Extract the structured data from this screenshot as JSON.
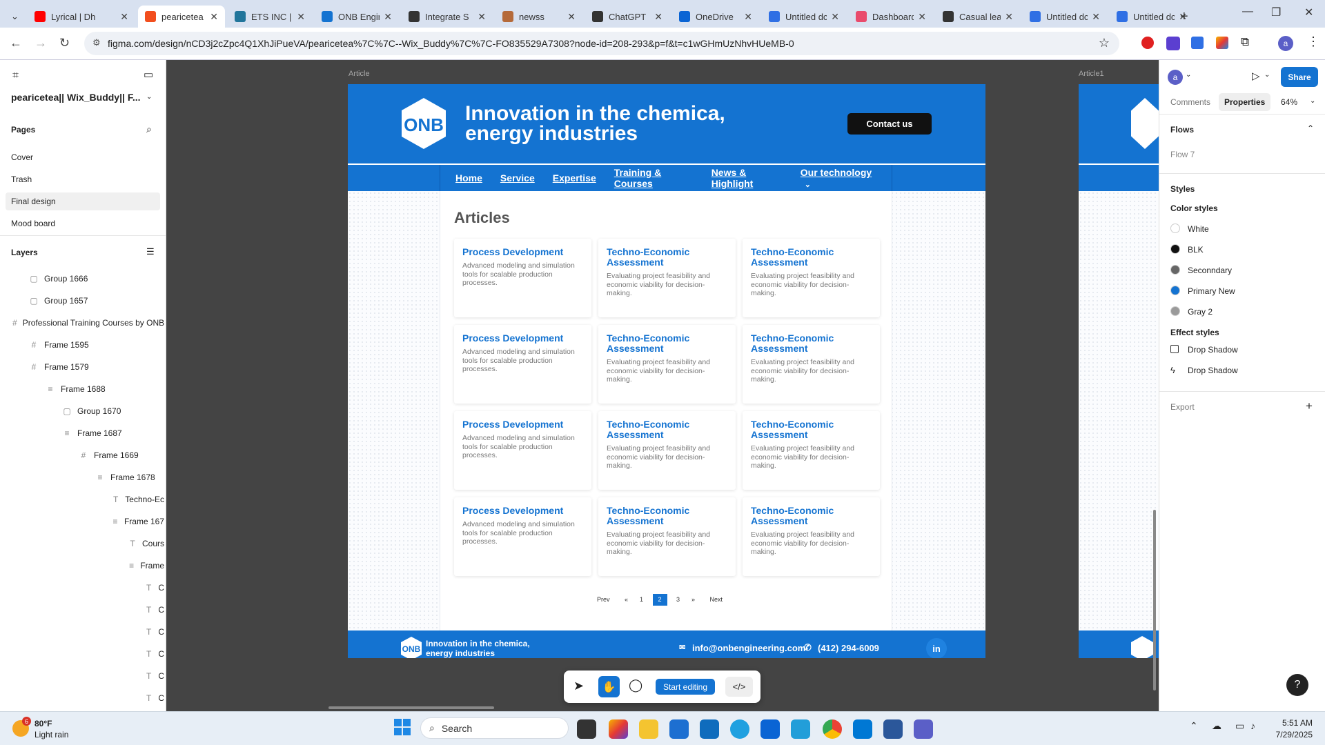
{
  "browser": {
    "tabs": [
      {
        "title": "Lyrical | Dh",
        "icon": "youtube-icon",
        "color": "#ff0000",
        "active": false
      },
      {
        "title": "pearicetea",
        "icon": "figma-icon",
        "color": "#f24e1e",
        "active": true
      },
      {
        "title": "ETS INC | t",
        "icon": "wordpress-icon",
        "color": "#21759b",
        "active": false
      },
      {
        "title": "ONB Engin",
        "icon": "onb-icon",
        "color": "#1473d1",
        "active": false
      },
      {
        "title": "Integrate S",
        "icon": "chatgpt-icon",
        "color": "#333333",
        "active": false
      },
      {
        "title": "newss",
        "icon": "doc-icon",
        "color": "#b56a3a",
        "active": false
      },
      {
        "title": "ChatGPT",
        "icon": "chatgpt-icon",
        "color": "#333333",
        "active": false
      },
      {
        "title": "OneDrive",
        "icon": "onedrive-icon",
        "color": "#0a64d4",
        "active": false
      },
      {
        "title": "Untitled dc",
        "icon": "docs-icon",
        "color": "#2f6fe4",
        "active": false
      },
      {
        "title": "Dashboard",
        "icon": "dashboard-icon",
        "color": "#e94b6c",
        "active": false
      },
      {
        "title": "Casual lea",
        "icon": "chatgpt-icon",
        "color": "#333333",
        "active": false
      },
      {
        "title": "Untitled dc",
        "icon": "docs-icon",
        "color": "#2f6fe4",
        "active": false
      },
      {
        "title": "Untitled dc",
        "icon": "docs-icon",
        "color": "#2f6fe4",
        "active": false
      }
    ],
    "url": "figma.com/design/nCD3j2cZpc4Q1XhJiPueVA/pearicetea%7C%7C--Wix_Buddy%7C%7C-FO835529A7308?node-id=208-293&p=f&t=c1wGHmUzNhvHUeMB-0"
  },
  "figma": {
    "file_title": "pearicetea|| Wix_Buddy|| F...",
    "pages_header": "Pages",
    "pages": [
      "Cover",
      "Trash",
      "Final design",
      "Mood board"
    ],
    "selected_page": "Final design",
    "layers_header": "Layers",
    "layers": [
      {
        "name": "Group 1666",
        "icon": "group-icon"
      },
      {
        "name": "Group 1657",
        "icon": "group-icon"
      },
      {
        "name": "Professional Training Courses by ONB",
        "icon": "frame-icon"
      },
      {
        "name": "Frame 1595",
        "icon": "frame-icon"
      },
      {
        "name": "Frame 1579",
        "icon": "frame-icon"
      },
      {
        "name": "Frame 1688",
        "icon": "autolayout-icon"
      },
      {
        "name": "Group 1670",
        "icon": "group-icon"
      },
      {
        "name": "Frame 1687",
        "icon": "autolayout-icon"
      },
      {
        "name": "Frame 1669",
        "icon": "frame-icon"
      },
      {
        "name": "Frame 1678",
        "icon": "autolayout-icon"
      },
      {
        "name": "Techno-Ec",
        "icon": "text-icon"
      },
      {
        "name": "Frame 167",
        "icon": "autolayout-icon"
      },
      {
        "name": "Cours",
        "icon": "text-icon"
      },
      {
        "name": "Frame",
        "icon": "autolayout-icon"
      },
      {
        "name": "C",
        "icon": "text-icon"
      },
      {
        "name": "C",
        "icon": "text-icon"
      },
      {
        "name": "C",
        "icon": "text-icon"
      },
      {
        "name": "C",
        "icon": "text-icon"
      },
      {
        "name": "C",
        "icon": "text-icon"
      },
      {
        "name": "C",
        "icon": "text-icon"
      }
    ],
    "frame_labels": {
      "main": "Article",
      "second": "Article1"
    },
    "right_panel": {
      "avatar": "a",
      "share": "Share",
      "tabs": [
        "Comments",
        "Properties"
      ],
      "zoom": "64%",
      "flows_header": "Flows",
      "flow": "Flow 7",
      "styles_header": "Styles",
      "color_styles_header": "Color styles",
      "color_styles": [
        {
          "name": "White",
          "color": "#ffffff"
        },
        {
          "name": "BLK",
          "color": "#111111"
        },
        {
          "name": "Seconndary",
          "color": "#666666"
        },
        {
          "name": "Primary New",
          "color": "#1473d1"
        },
        {
          "name": "Gray 2",
          "color": "#9a9a9a"
        }
      ],
      "effect_styles_header": "Effect styles",
      "effect_styles": [
        "Drop Shadow",
        "Drop Shadow"
      ],
      "export": "Export"
    },
    "bottom_toolbar": {
      "start_editing": "Start editing"
    }
  },
  "design": {
    "headline": "Innovation in the chemica, energy industries",
    "contact": "Contact us",
    "nav": [
      "Home",
      "Service",
      "Expertise",
      "Training & Courses",
      "News & Highlight",
      "Our technology"
    ],
    "section_title": "Articles",
    "cards": [
      {
        "title": "Process Development",
        "desc": "Advanced modeling and simulation tools for scalable production processes."
      },
      {
        "title": "Techno-Economic Assessment",
        "desc": "Evaluating project feasibility and economic viability for decision-making."
      },
      {
        "title": "Techno-Economic Assessment",
        "desc": "Evaluating project feasibility and economic viability for decision-making."
      },
      {
        "title": "Process Development",
        "desc": "Advanced modeling and simulation tools for scalable production processes."
      },
      {
        "title": "Techno-Economic Assessment",
        "desc": "Evaluating project feasibility and economic viability for decision-making."
      },
      {
        "title": "Techno-Economic Assessment",
        "desc": "Evaluating project feasibility and economic viability for decision-making."
      },
      {
        "title": "Process Development",
        "desc": "Advanced modeling and simulation tools for scalable production processes."
      },
      {
        "title": "Techno-Economic Assessment",
        "desc": "Evaluating project feasibility and economic viability for decision-making."
      },
      {
        "title": "Techno-Economic Assessment",
        "desc": "Evaluating project feasibility and economic viability for decision-making."
      },
      {
        "title": "Process Development",
        "desc": "Advanced modeling and simulation tools for scalable production processes."
      },
      {
        "title": "Techno-Economic Assessment",
        "desc": "Evaluating project feasibility and economic viability for decision-making."
      },
      {
        "title": "Techno-Economic Assessment",
        "desc": "Evaluating project feasibility and economic viability for decision-making."
      }
    ],
    "pagination": {
      "prev": "Prev",
      "first": "«",
      "pages": [
        "1",
        "2",
        "3"
      ],
      "current": "2",
      "last": "»",
      "next": "Next"
    },
    "footer": {
      "tagline": "Innovation in the chemica, energy industries",
      "email": "info@onbengineering.com",
      "phone": "(412) 294-6009",
      "social": "in"
    }
  },
  "taskbar": {
    "weather_temp": "80°F",
    "weather_desc": "Light rain",
    "weather_badge": "6",
    "search": "Search",
    "time": "5:51 AM",
    "date": "7/29/2025"
  }
}
